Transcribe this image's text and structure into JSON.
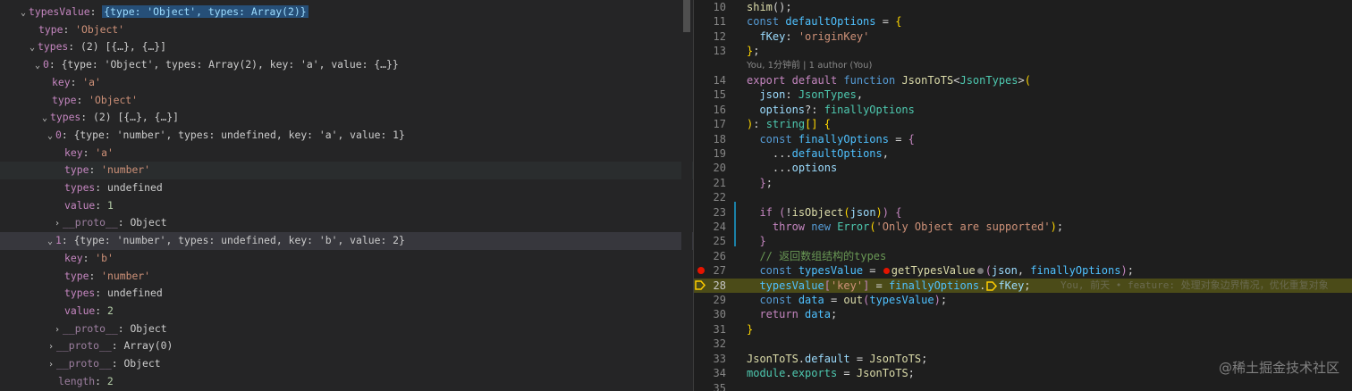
{
  "variables": {
    "rows": [
      {
        "chev": "⌄",
        "name": "typesValue",
        "sep": ": ",
        "value": "{type: 'Object', types: Array(2)}",
        "selected": true
      },
      {
        "name": "type",
        "sep": ": ",
        "value": "'Object'"
      },
      {
        "chev": "⌄",
        "name": "types",
        "sep": ": ",
        "value": "(2) [{…}, {…}]"
      },
      {
        "chev": "⌄",
        "name": "0",
        "sep": ": ",
        "value": "{type: 'Object', types: Array(2), key: 'a', value: {…}}"
      },
      {
        "name": "key",
        "sep": ": ",
        "value": "'a'"
      },
      {
        "name": "type",
        "sep": ": ",
        "value": "'Object'"
      },
      {
        "chev": "⌄",
        "name": "types",
        "sep": ": ",
        "value": "(2) [{…}, {…}]"
      },
      {
        "chev": "⌄",
        "name": "0",
        "sep": ": ",
        "value": "{type: 'number', types: undefined, key: 'a', value: 1}"
      },
      {
        "name": "key",
        "sep": ": ",
        "value": "'a'"
      },
      {
        "name": "type",
        "sep": ": ",
        "value": "'number'"
      },
      {
        "name": "types",
        "sep": ": ",
        "value": "undefined"
      },
      {
        "name": "value",
        "sep": ": ",
        "value": "1"
      },
      {
        "chev": "›",
        "name": "__proto__",
        "sep": ": ",
        "value": "Object"
      },
      {
        "chev": "⌄",
        "name": "1",
        "sep": ": ",
        "value": "{type: 'number', types: undefined, key: 'b', value: 2}"
      },
      {
        "name": "key",
        "sep": ": ",
        "value": "'b'"
      },
      {
        "name": "type",
        "sep": ": ",
        "value": "'number'"
      },
      {
        "name": "types",
        "sep": ": ",
        "value": "undefined"
      },
      {
        "name": "value",
        "sep": ": ",
        "value": "2"
      },
      {
        "chev": "›",
        "name": "__proto__",
        "sep": ": ",
        "value": "Object"
      },
      {
        "chev": "›",
        "name": "__proto__",
        "sep": ": ",
        "value": "Array(0)"
      },
      {
        "chev": "›",
        "name": "__proto__",
        "sep": ": ",
        "value": "Object"
      },
      {
        "name": "length",
        "sep": ": ",
        "value": "2"
      }
    ]
  },
  "editor": {
    "blame": "You, 1分钟前 | 1 author (You)",
    "inline_hint": "You, 前天 • feature: 处理对象边界情况，优化重复对象",
    "line_numbers": [
      "10",
      "11",
      "12",
      "13",
      "14",
      "15",
      "16",
      "17",
      "18",
      "19",
      "20",
      "21",
      "22",
      "23",
      "24",
      "25",
      "26",
      "27",
      "28",
      "29",
      "30",
      "31",
      "32",
      "33",
      "34",
      "35"
    ],
    "current_line": "28",
    "breakpoint_line": "27"
  },
  "watermark": "@稀土掘金技术社区"
}
